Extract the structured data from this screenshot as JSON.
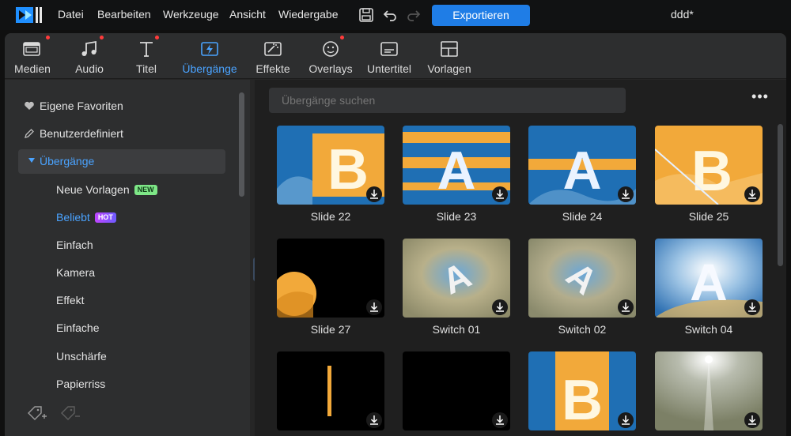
{
  "menubar": {
    "items": [
      "Datei",
      "Bearbeiten",
      "Werkzeuge",
      "Ansicht",
      "Wiedergabe"
    ],
    "export_label": "Exportieren",
    "project_title": "ddd*"
  },
  "tabs": [
    {
      "label": "Medien",
      "icon": "media-icon",
      "dot": true
    },
    {
      "label": "Audio",
      "icon": "music-icon",
      "dot": true
    },
    {
      "label": "Titel",
      "icon": "title-icon",
      "dot": true
    },
    {
      "label": "Übergänge",
      "icon": "transition-icon",
      "dot": false,
      "active": true
    },
    {
      "label": "Effekte",
      "icon": "effects-icon",
      "dot": false
    },
    {
      "label": "Overlays",
      "icon": "overlay-icon",
      "dot": true
    },
    {
      "label": "Untertitel",
      "icon": "subtitle-icon",
      "dot": false
    },
    {
      "label": "Vorlagen",
      "icon": "template-icon",
      "dot": false
    }
  ],
  "sidebar": {
    "favorites": "Eigene Favoriten",
    "custom": "Benutzerdefiniert",
    "transitions": "Übergänge",
    "sub_items": [
      {
        "label": "Neue Vorlagen",
        "badge": "NEW"
      },
      {
        "label": "Beliebt",
        "badge": "HOT",
        "selected": true
      },
      {
        "label": "Einfach"
      },
      {
        "label": "Kamera"
      },
      {
        "label": "Effekt"
      },
      {
        "label": "Einfache"
      },
      {
        "label": "Unschärfe"
      },
      {
        "label": "Papierriss"
      }
    ]
  },
  "search": {
    "placeholder": "Übergänge suchen"
  },
  "grid": {
    "items": [
      {
        "name": "Slide 22"
      },
      {
        "name": "Slide 23"
      },
      {
        "name": "Slide 24"
      },
      {
        "name": "Slide 25"
      },
      {
        "name": "Slide 27"
      },
      {
        "name": "Switch 01"
      },
      {
        "name": "Switch 02"
      },
      {
        "name": "Switch 04"
      },
      {
        "name": ""
      },
      {
        "name": ""
      },
      {
        "name": ""
      },
      {
        "name": ""
      }
    ]
  },
  "colors": {
    "accent": "#1f7de6",
    "active_tab": "#4aa3ff",
    "new_badge": "#7ee787",
    "hot_badge": "#a64dff"
  }
}
